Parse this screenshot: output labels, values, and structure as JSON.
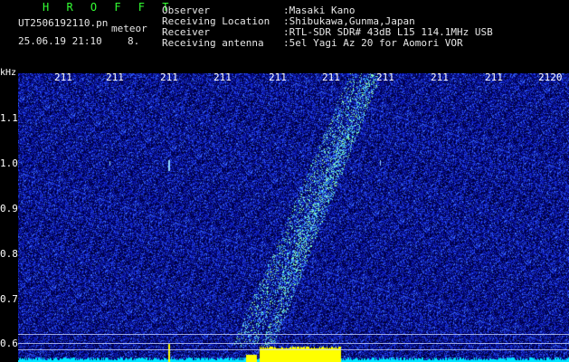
{
  "app_title": "H R O F F T",
  "file": {
    "name": "UT2506192110.pn",
    "suffix": "meteor",
    "datetime": "25.06.19 21:10",
    "counter": "8."
  },
  "info": [
    {
      "label": "Observer",
      "value": ":Masaki Kano"
    },
    {
      "label": "Receiving Location",
      "value": ":Shibukawa,Gunma,Japan"
    },
    {
      "label": "Receiver",
      "value": ":RTL-SDR SDR# 43dB L15 114.1MHz USB"
    },
    {
      "label": "Receiving antenna",
      "value": ":5el Yagi Az 20 for Aomori VOR"
    }
  ],
  "axis": {
    "unit": "kHz",
    "time_ticks": [
      "211",
      "211",
      "211",
      "211",
      "211",
      "211",
      "211",
      "211",
      "211",
      "2120"
    ],
    "freq_ticks": [
      "1.1",
      "1.0",
      "0.9",
      "0.8",
      "0.7",
      "0.6"
    ]
  },
  "colors": {
    "background": "#000000",
    "noise": "#0a1f8c",
    "meteor_trace": "#7fffd4",
    "baseline": "#00e5ff",
    "burst": "#ffff00",
    "title_green": "#33ff33"
  }
}
